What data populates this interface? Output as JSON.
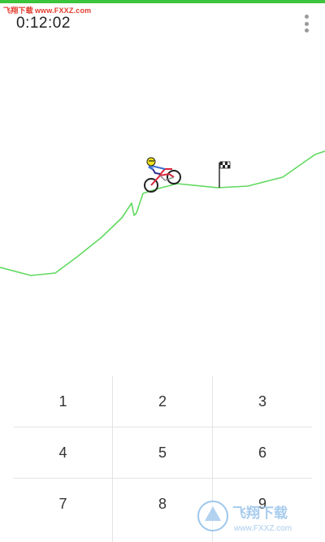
{
  "game": {
    "timer": "0:12:02",
    "accent_color": "#3cc43c",
    "track_color": "#5fd95f",
    "menu_icon": "more-vertical-icon"
  },
  "keypad": {
    "keys": [
      "1",
      "2",
      "3",
      "4",
      "5",
      "6",
      "7",
      "8",
      "9"
    ]
  },
  "watermark": {
    "top_cn": "飞翔下载",
    "top_url": "www.FXXZ.com",
    "bottom_cn": "飞翔下载",
    "bottom_url": "www.FXXZ.com"
  }
}
